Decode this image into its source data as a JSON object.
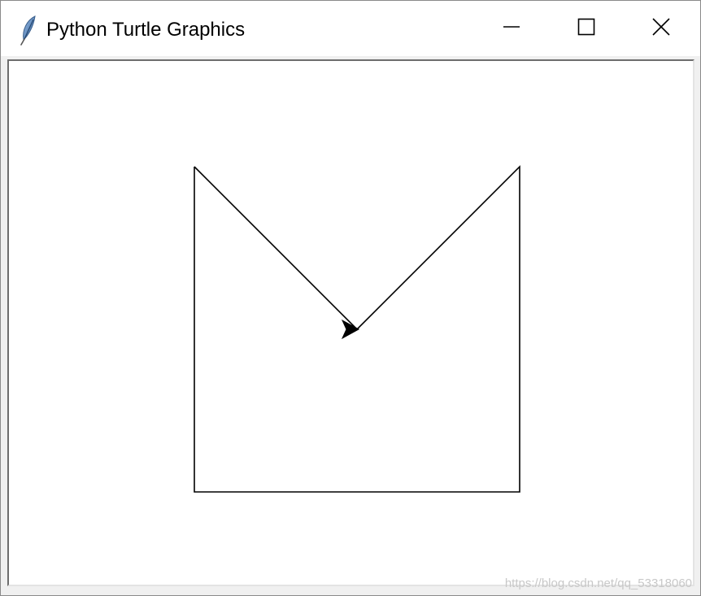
{
  "window": {
    "title": "Python Turtle Graphics",
    "icon": "feather-icon",
    "controls": {
      "minimize_icon": "minimize-icon",
      "maximize_icon": "maximize-icon",
      "close_icon": "close-icon"
    }
  },
  "canvas": {
    "background": "#ffffff",
    "pen_color": "#000000",
    "turtle_shape": "arrow",
    "turtle_heading": "east"
  },
  "watermark": {
    "text": "https://blog.csdn.net/qq_53318060"
  }
}
